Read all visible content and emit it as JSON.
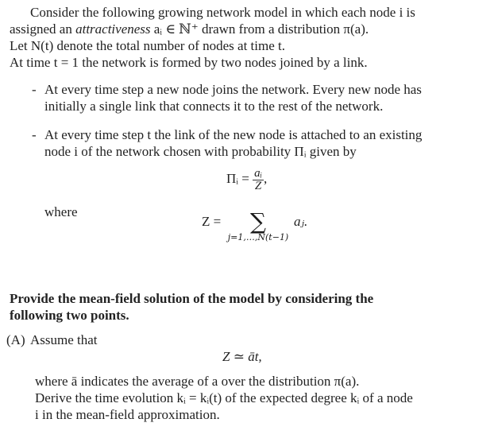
{
  "intro": {
    "line1": "Consider the following growing network model in which each node i is",
    "line2_pre": "assigned an ",
    "line2_em": "attractiveness",
    "line2_post": " aᵢ ∈ ℕ⁺ drawn from a distribution π(a).",
    "line3": "Let N(t) denote the total number of nodes at time t.",
    "line4": "At time t = 1 the network is formed by two nodes joined by a link."
  },
  "bullets": [
    {
      "marker": "-",
      "line1": "At every time step a new node joins the network. Every new node has",
      "line2": "initially a single link that connects it to the rest of the network."
    },
    {
      "marker": "-",
      "line1": "At every time step t the link of the new node is attached to an existing",
      "line2": "node i of the network chosen with probability Πᵢ given by"
    }
  ],
  "equation1": {
    "lhs": "Πᵢ =",
    "numerator": "aᵢ",
    "denominator": "Z",
    "trail": ","
  },
  "where_label": "where",
  "equation2": {
    "lhs": "Z =",
    "sum_symbol": "∑",
    "sum_limits": "j=1,…,N(t−1)",
    "term": "aⱼ."
  },
  "task": {
    "line1": "Provide the mean-field solution of the model by considering the",
    "line2": "following two points."
  },
  "partA": {
    "label": "(A)",
    "intro": "Assume that",
    "equation": "Z ≃ āt,",
    "line1": "where ā indicates the average of a over the distribution π(a).",
    "line2": "Derive the time evolution kᵢ = kᵢ(t) of the expected degree kᵢ of a node",
    "line3": "i in the mean-field approximation."
  }
}
